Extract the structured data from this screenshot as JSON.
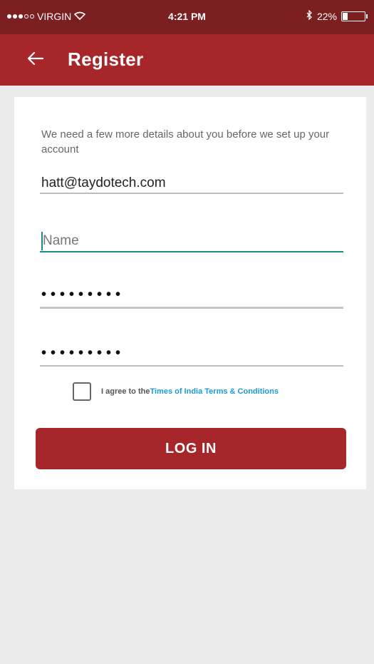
{
  "status_bar": {
    "carrier": "VIRGIN",
    "time": "4:21 PM",
    "battery": "22%",
    "battery_level": 0.22,
    "signal_strength": 3
  },
  "app_bar": {
    "title": "Register",
    "back_icon": "arrow-left-icon"
  },
  "form": {
    "intro": "We need a few more details about you before we set up your account",
    "email_value": "hatt@taydotech.com",
    "name_placeholder": "Name",
    "password_mask": "•••••••••",
    "confirm_password_mask": "•••••••••",
    "agree_text": "I agree to the",
    "terms_link": "Times of India Terms & Conditions",
    "submit_label": "LOG IN"
  },
  "colors": {
    "status_bar": "#7c1f21",
    "app_bar": "#a6262a",
    "button": "#a6262a",
    "link": "#1a9bd7",
    "focus_line": "#1a8c84"
  }
}
